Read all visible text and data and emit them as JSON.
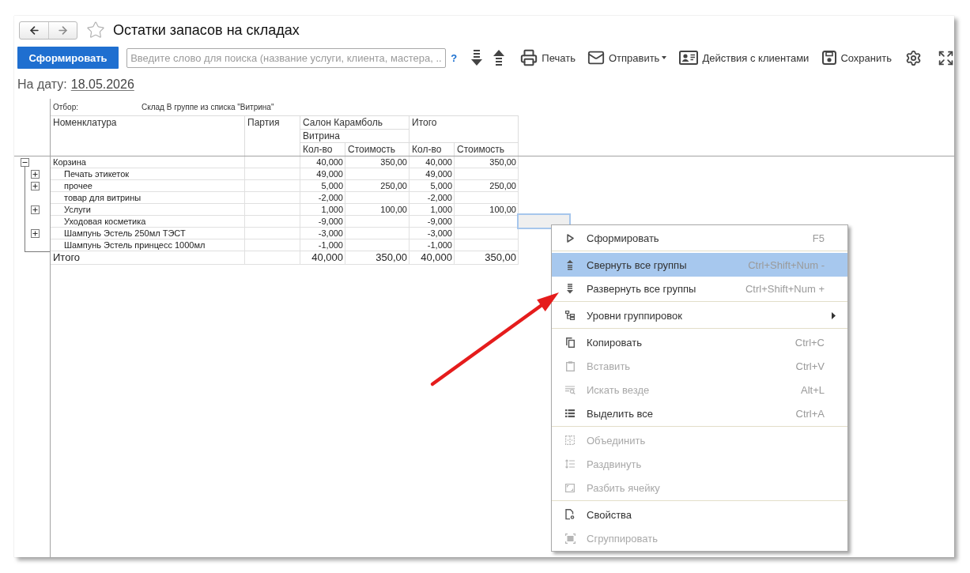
{
  "window": {
    "title": "Остатки запасов на складах",
    "favorite": false
  },
  "navigation": [
    {
      "kind": "back",
      "disabled": false
    },
    {
      "kind": "forward",
      "disabled": true
    }
  ],
  "toolbar": {
    "generate_button": "Сформировать",
    "search": {
      "placeholder": "Введите слово для поиска (название услуги, клиента, мастера, ..."
    },
    "help": "?",
    "actions": [
      {
        "kind": "expand_all",
        "dropdown": false
      },
      {
        "kind": "collapse_all",
        "dropdown": false
      },
      {
        "kind": "print",
        "label": "Печать",
        "dropdown": false
      },
      {
        "kind": "send",
        "label": "Отправить",
        "dropdown": true
      },
      {
        "kind": "clients",
        "label": "Действия с клиентами",
        "dropdown": false
      },
      {
        "kind": "save",
        "label": "Сохранить",
        "dropdown": false
      },
      {
        "kind": "settings",
        "dropdown": false
      },
      {
        "kind": "fullscreen",
        "dropdown": false
      }
    ]
  },
  "date_field": {
    "label": "На дату:",
    "value": "18.05.2026"
  },
  "report": {
    "filter": {
      "label": "Отбор:",
      "value": "Склад В группе из списка \"Витрина\""
    },
    "columns": [
      {
        "label": "Номенклатура"
      },
      {
        "label": "Партия"
      }
    ],
    "column_groups": [
      {
        "label": "Салон Карамболь",
        "sublabel": "Витрина",
        "subcolumns": [
          "Кол-во",
          "Стоимость"
        ]
      },
      {
        "label": "Итого",
        "subcolumns": [
          "Кол-во",
          "Стоимость"
        ]
      }
    ],
    "rows": [
      {
        "name": "Корзина",
        "kind": "group",
        "expanded": true,
        "active_cell": false,
        "values": [
          {
            "qty": "40,000",
            "cost": "350,00"
          },
          {
            "qty": "40,000",
            "cost": "350,00"
          }
        ],
        "children": [
          {
            "name": "Печать этикеток",
            "kind": "group",
            "expanded": false,
            "active_cell": false,
            "values": [
              {
                "qty": "49,000"
              },
              {
                "qty": "49,000"
              }
            ]
          },
          {
            "name": "прочее",
            "kind": "group",
            "expanded": false,
            "active_cell": false,
            "values": [
              {
                "qty": "5,000",
                "cost": "250,00"
              },
              {
                "qty": "5,000",
                "cost": "250,00"
              }
            ]
          },
          {
            "name": "товар для витрины",
            "kind": "item",
            "active_cell": false,
            "values": [
              {
                "qty": "-2,000"
              },
              {
                "qty": "-2,000"
              }
            ]
          },
          {
            "name": "Услуги",
            "kind": "group",
            "expanded": false,
            "active_cell": false,
            "values": [
              {
                "qty": "1,000",
                "cost": "100,00"
              },
              {
                "qty": "1,000",
                "cost": "100,00"
              }
            ]
          },
          {
            "name": "Уходовая косметика",
            "kind": "item",
            "active_cell": true,
            "values": [
              {
                "qty": "-9,000"
              },
              {
                "qty": "-9,000"
              }
            ]
          },
          {
            "name": "Шампунь Эстель 250мл ТЭСТ",
            "kind": "group",
            "expanded": false,
            "active_cell": false,
            "values": [
              {
                "qty": "-3,000"
              },
              {
                "qty": "-3,000"
              }
            ]
          },
          {
            "name": "Шампунь Эстель принцесс 1000мл",
            "kind": "item",
            "active_cell": false,
            "values": [
              {
                "qty": "-1,000"
              },
              {
                "qty": "-1,000"
              }
            ]
          }
        ]
      }
    ],
    "total_row": {
      "label": "Итого",
      "values": [
        {
          "qty": "40,000",
          "cost": "350,00"
        },
        {
          "qty": "40,000",
          "cost": "350,00"
        }
      ]
    }
  },
  "context_menu": {
    "items": [
      {
        "kind": "generate",
        "label": "Сформировать",
        "shortcut": "F5",
        "disabled": false,
        "highlighted": false,
        "submenu": false
      },
      {
        "kind": "separator"
      },
      {
        "kind": "collapse",
        "label": "Свернуть все группы",
        "shortcut": "Ctrl+Shift+Num -",
        "disabled": false,
        "highlighted": true,
        "submenu": false
      },
      {
        "kind": "expand",
        "label": "Развернуть все группы",
        "shortcut": "Ctrl+Shift+Num +",
        "disabled": false,
        "highlighted": false,
        "submenu": false
      },
      {
        "kind": "separator"
      },
      {
        "kind": "levels",
        "label": "Уровни группировок",
        "disabled": false,
        "highlighted": false,
        "submenu": true
      },
      {
        "kind": "separator"
      },
      {
        "kind": "copy",
        "label": "Копировать",
        "shortcut": "Ctrl+C",
        "disabled": false,
        "highlighted": false,
        "submenu": false
      },
      {
        "kind": "paste",
        "label": "Вставить",
        "shortcut": "Ctrl+V",
        "disabled": true,
        "highlighted": false,
        "submenu": false
      },
      {
        "kind": "find",
        "label": "Искать везде",
        "shortcut": "Alt+L",
        "disabled": true,
        "highlighted": false,
        "submenu": false
      },
      {
        "kind": "select_all",
        "label": "Выделить все",
        "shortcut": "Ctrl+A",
        "disabled": false,
        "highlighted": false,
        "submenu": false
      },
      {
        "kind": "separator"
      },
      {
        "kind": "merge",
        "label": "Объединить",
        "disabled": true,
        "highlighted": false,
        "submenu": false
      },
      {
        "kind": "spread",
        "label": "Раздвинуть",
        "disabled": true,
        "highlighted": false,
        "submenu": false
      },
      {
        "kind": "split",
        "label": "Разбить ячейку",
        "disabled": true,
        "highlighted": false,
        "submenu": false
      },
      {
        "kind": "separator"
      },
      {
        "kind": "properties",
        "label": "Свойства",
        "disabled": false,
        "highlighted": false,
        "submenu": false
      },
      {
        "kind": "group",
        "label": "Сгруппировать",
        "disabled": true,
        "highlighted": false,
        "submenu": false
      }
    ]
  }
}
